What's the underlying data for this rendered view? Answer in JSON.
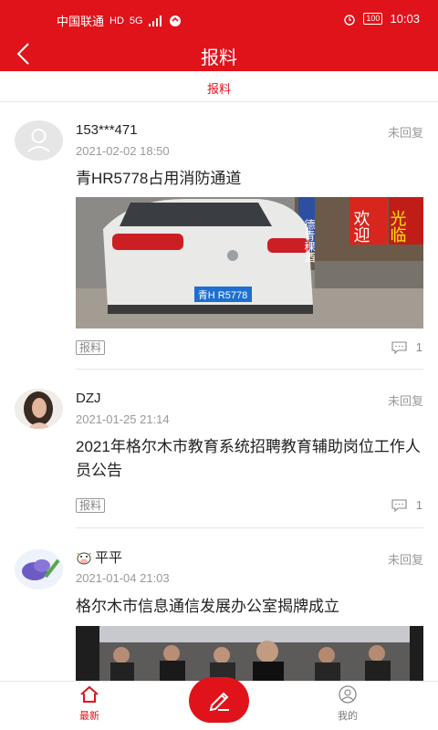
{
  "statusbar": {
    "carrier": "中国联通",
    "hd": "HD",
    "network": "5G",
    "time": "10:03",
    "battery": "100"
  },
  "header": {
    "title": "报料"
  },
  "subtab": {
    "label": "报料"
  },
  "posts": [
    {
      "user": "153***471",
      "status": "未回复",
      "time": "2021-02-02 18:50",
      "title": "青HR5778占用消防通道",
      "tag": "报料",
      "comments": "1",
      "image": {
        "sign1": "德青稞酒",
        "sign2": "欢迎",
        "sign3": "光临",
        "plate": "青H R5778"
      }
    },
    {
      "user": "DZJ",
      "status": "未回复",
      "time": "2021-01-25 21:14",
      "title": "2021年格尔木市教育系统招聘教育辅助岗位工作人员公告",
      "tag": "报料",
      "comments": "1"
    },
    {
      "user": "平平",
      "status": "未回复",
      "time": "2021-01-04 21:03",
      "title": "格尔木市信息通信发展办公室揭牌成立"
    }
  ],
  "tabbar": {
    "new_label": "最新",
    "mine_label": "我的"
  },
  "colors": {
    "brand": "#e0131a"
  }
}
